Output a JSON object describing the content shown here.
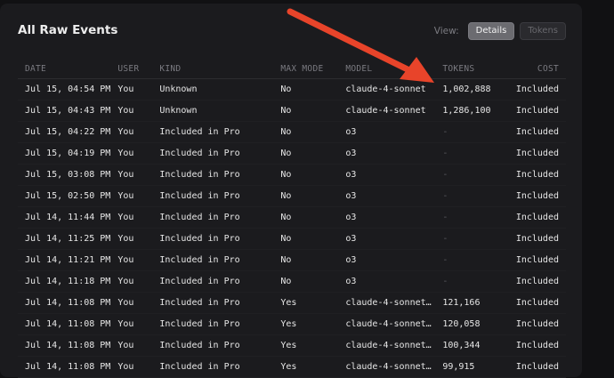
{
  "panel": {
    "title": "All Raw Events"
  },
  "view": {
    "label": "View:",
    "options": [
      "Details",
      "Tokens"
    ],
    "selected": "Details"
  },
  "columns": [
    "DATE",
    "USER",
    "KIND",
    "MAX MODE",
    "MODEL",
    "TOKENS",
    "COST"
  ],
  "rows": [
    {
      "date": "Jul 15, 04:54 PM",
      "user": "You",
      "kind": "Unknown",
      "max_mode": "No",
      "model": "claude-4-sonnet",
      "tokens": "1,002,888",
      "cost": "Included"
    },
    {
      "date": "Jul 15, 04:43 PM",
      "user": "You",
      "kind": "Unknown",
      "max_mode": "No",
      "model": "claude-4-sonnet",
      "tokens": "1,286,100",
      "cost": "Included"
    },
    {
      "date": "Jul 15, 04:22 PM",
      "user": "You",
      "kind": "Included in Pro",
      "max_mode": "No",
      "model": "o3",
      "tokens": "-",
      "cost": "Included"
    },
    {
      "date": "Jul 15, 04:19 PM",
      "user": "You",
      "kind": "Included in Pro",
      "max_mode": "No",
      "model": "o3",
      "tokens": "-",
      "cost": "Included"
    },
    {
      "date": "Jul 15, 03:08 PM",
      "user": "You",
      "kind": "Included in Pro",
      "max_mode": "No",
      "model": "o3",
      "tokens": "-",
      "cost": "Included"
    },
    {
      "date": "Jul 15, 02:50 PM",
      "user": "You",
      "kind": "Included in Pro",
      "max_mode": "No",
      "model": "o3",
      "tokens": "-",
      "cost": "Included"
    },
    {
      "date": "Jul 14, 11:44 PM",
      "user": "You",
      "kind": "Included in Pro",
      "max_mode": "No",
      "model": "o3",
      "tokens": "-",
      "cost": "Included"
    },
    {
      "date": "Jul 14, 11:25 PM",
      "user": "You",
      "kind": "Included in Pro",
      "max_mode": "No",
      "model": "o3",
      "tokens": "-",
      "cost": "Included"
    },
    {
      "date": "Jul 14, 11:21 PM",
      "user": "You",
      "kind": "Included in Pro",
      "max_mode": "No",
      "model": "o3",
      "tokens": "-",
      "cost": "Included"
    },
    {
      "date": "Jul 14, 11:18 PM",
      "user": "You",
      "kind": "Included in Pro",
      "max_mode": "No",
      "model": "o3",
      "tokens": "-",
      "cost": "Included"
    },
    {
      "date": "Jul 14, 11:08 PM",
      "user": "You",
      "kind": "Included in Pro",
      "max_mode": "Yes",
      "model": "claude-4-sonnet-…",
      "tokens": "121,166",
      "cost": "Included"
    },
    {
      "date": "Jul 14, 11:08 PM",
      "user": "You",
      "kind": "Included in Pro",
      "max_mode": "Yes",
      "model": "claude-4-sonnet-…",
      "tokens": "120,058",
      "cost": "Included"
    },
    {
      "date": "Jul 14, 11:08 PM",
      "user": "You",
      "kind": "Included in Pro",
      "max_mode": "Yes",
      "model": "claude-4-sonnet-…",
      "tokens": "100,344",
      "cost": "Included"
    },
    {
      "date": "Jul 14, 11:08 PM",
      "user": "You",
      "kind": "Included in Pro",
      "max_mode": "Yes",
      "model": "claude-4-sonnet-…",
      "tokens": "99,915",
      "cost": "Included"
    }
  ],
  "annotation": {
    "arrow_color": "#e8442a"
  },
  "colors": {
    "background": "#111113",
    "panel": "#1b1b1e",
    "text": "#e6e6e6",
    "muted": "#7a7a80"
  }
}
